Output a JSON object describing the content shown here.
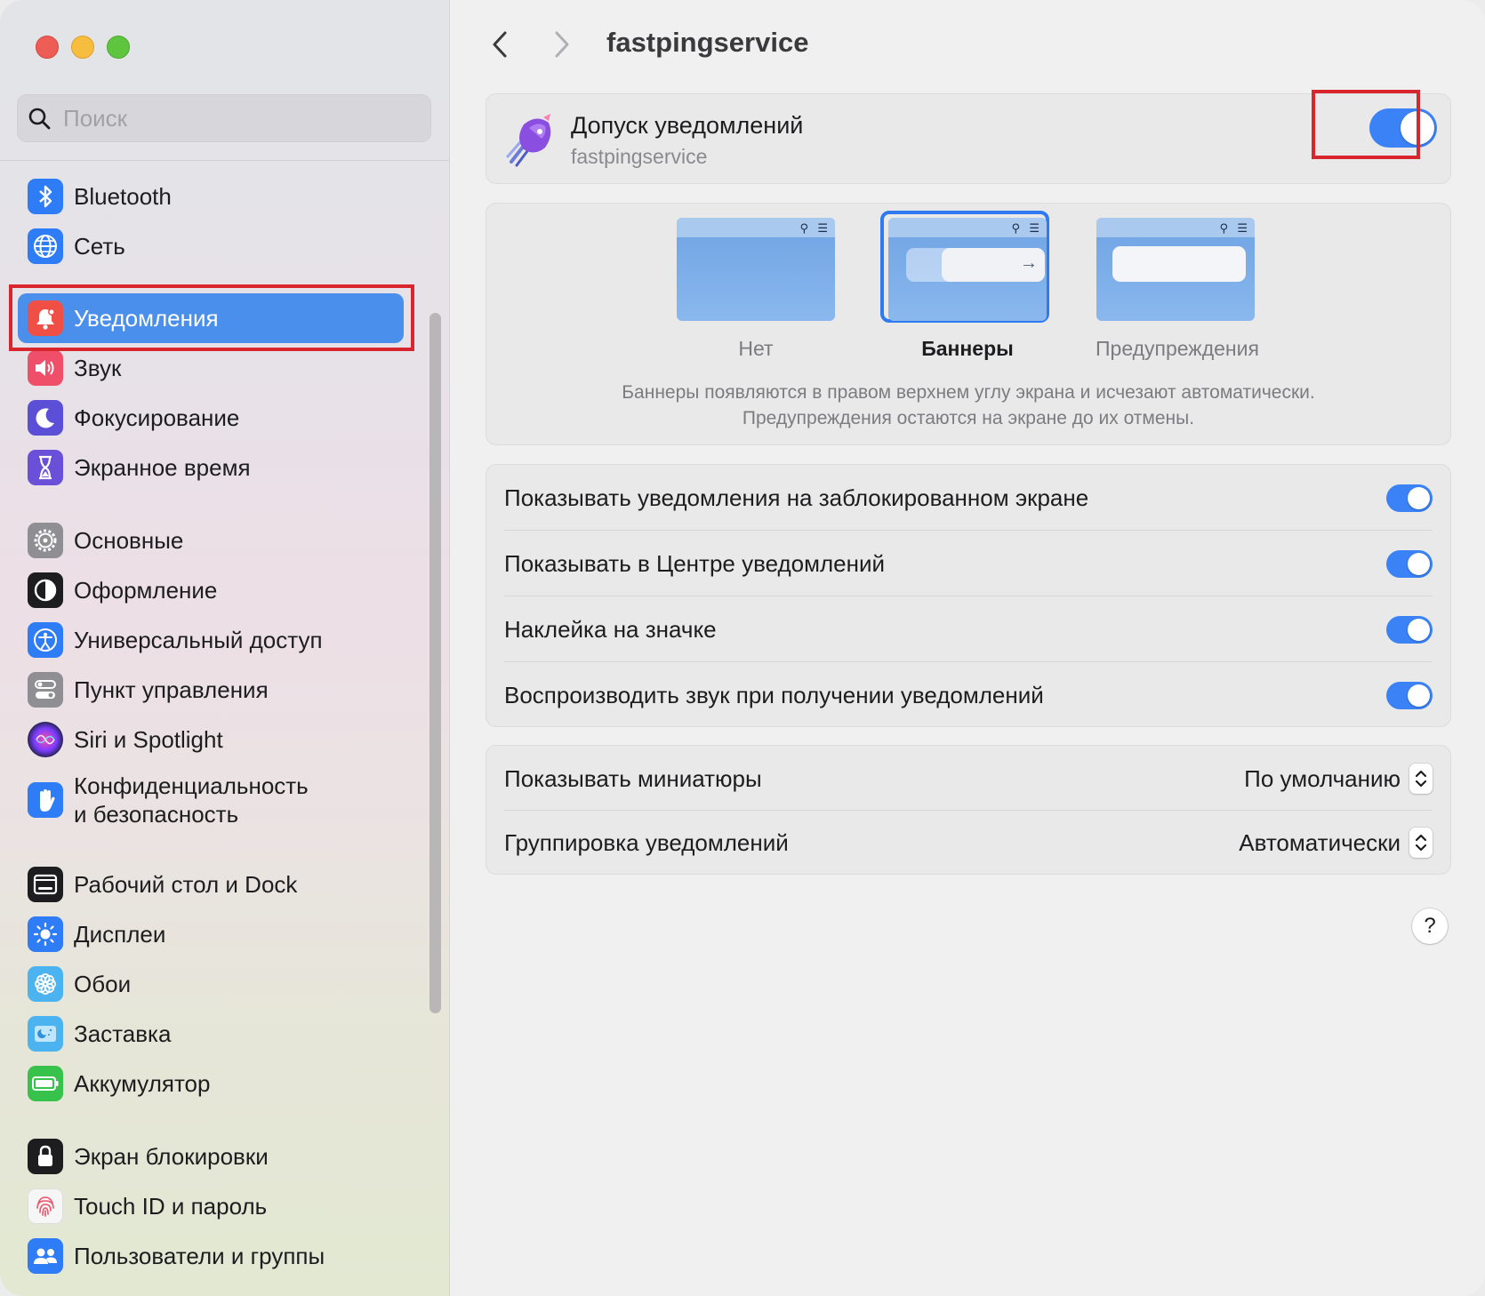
{
  "search": {
    "placeholder": "Поиск"
  },
  "sidebar": {
    "items": [
      {
        "label": "Bluetooth",
        "icon": "bluetooth-icon",
        "color": "#2e7cf6"
      },
      {
        "label": "Сеть",
        "icon": "globe-icon",
        "color": "#2e7cf6"
      },
      {
        "label": "Уведомления",
        "icon": "bell-icon",
        "color": "#f04f45",
        "active": true
      },
      {
        "label": "Звук",
        "icon": "speaker-icon",
        "color": "#f04f6a"
      },
      {
        "label": "Фокусирование",
        "icon": "moon-icon",
        "color": "#5b4fd8"
      },
      {
        "label": "Экранное время",
        "icon": "hourglass-icon",
        "color": "#6a4fd8"
      },
      {
        "label": "Основные",
        "icon": "gear-icon",
        "color": "#8e8e93"
      },
      {
        "label": "Оформление",
        "icon": "appearance-icon",
        "color": "#1d1d1f"
      },
      {
        "label": "Универсальный доступ",
        "icon": "accessibility-icon",
        "color": "#2e7cf6"
      },
      {
        "label": "Пункт управления",
        "icon": "control-center-icon",
        "color": "#8e8e93"
      },
      {
        "label": "Siri и Spotlight",
        "icon": "siri-icon",
        "color": "#3b2a7a"
      },
      {
        "label": "Конфиденциальность\nи безопасность",
        "icon": "hand-icon",
        "color": "#2e7cf6"
      },
      {
        "label": "Рабочий стол и Dock",
        "icon": "dock-icon",
        "color": "#1d1d1f"
      },
      {
        "label": "Дисплеи",
        "icon": "sun-icon",
        "color": "#2e7cf6"
      },
      {
        "label": "Обои",
        "icon": "flower-icon",
        "color": "#4bb4f0"
      },
      {
        "label": "Заставка",
        "icon": "screensaver-icon",
        "color": "#4bb4f0"
      },
      {
        "label": "Аккумулятор",
        "icon": "battery-icon",
        "color": "#37c24b"
      },
      {
        "label": "Экран блокировки",
        "icon": "lock-icon",
        "color": "#1d1d1f"
      },
      {
        "label": "Touch ID и пароль",
        "icon": "fingerprint-icon",
        "color": "#f2f2f2"
      },
      {
        "label": "Пользователи и группы",
        "icon": "users-icon",
        "color": "#2e7cf6"
      }
    ]
  },
  "header": {
    "title": "fastpingservice"
  },
  "allow": {
    "title": "Допуск уведомлений",
    "subtitle": "fastpingservice",
    "enabled": true
  },
  "styles": {
    "options": [
      {
        "label": "Нет",
        "selected": false
      },
      {
        "label": "Баннеры",
        "selected": true
      },
      {
        "label": "Предупреждения",
        "selected": false
      }
    ],
    "description_line1": "Баннеры появляются в правом верхнем углу экрана и исчезают автоматически.",
    "description_line2": "Предупреждения остаются на экране до их отмены."
  },
  "settings": [
    {
      "label": "Показывать уведомления на заблокированном экране",
      "enabled": true
    },
    {
      "label": "Показывать в Центре уведомлений",
      "enabled": true
    },
    {
      "label": "Наклейка на значке",
      "enabled": true
    },
    {
      "label": "Воспроизводить звук при получении уведомлений",
      "enabled": true
    }
  ],
  "selects": [
    {
      "label": "Показывать миниатюры",
      "value": "По умолчанию"
    },
    {
      "label": "Группировка уведомлений",
      "value": "Автоматически"
    }
  ],
  "help": {
    "label": "?"
  },
  "colors": {
    "accent": "#3a82f6",
    "highlight": "#d9262e"
  }
}
